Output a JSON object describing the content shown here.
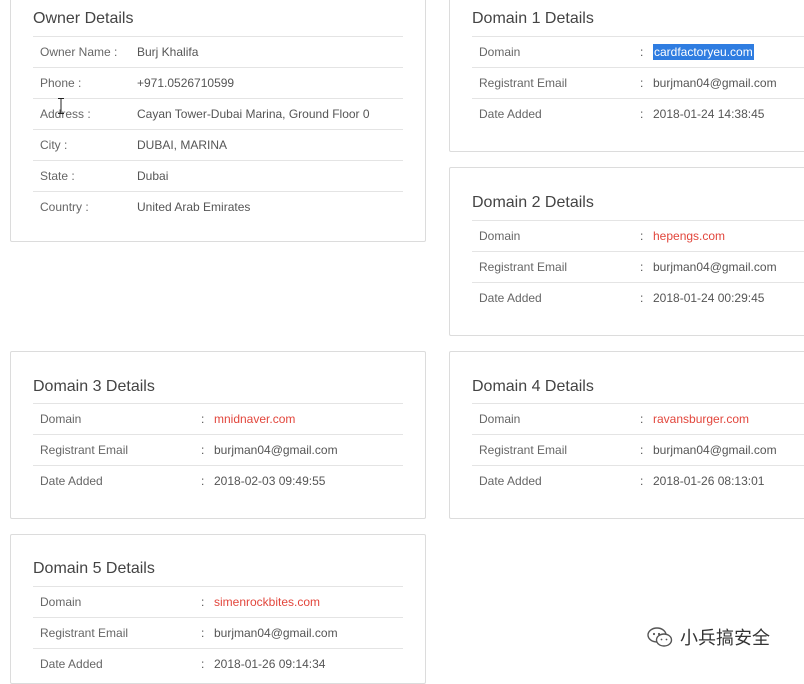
{
  "owner": {
    "title": "Owner Details",
    "rows": [
      {
        "label": "Owner Name :",
        "value": "Burj Khalifa"
      },
      {
        "label": "Phone :",
        "value": "+971.0526710599"
      },
      {
        "label": "Address :",
        "value": "Cayan Tower-Dubai Marina, Ground Floor 0"
      },
      {
        "label": "City :",
        "value": "DUBAI, MARINA"
      },
      {
        "label": "State :",
        "value": "Dubai"
      },
      {
        "label": "Country :",
        "value": "United Arab Emirates"
      }
    ]
  },
  "domains": [
    {
      "title": "Domain 1 Details",
      "rows": [
        {
          "label": "Domain",
          "sep": ":",
          "value": "cardfactoryeu.com"
        },
        {
          "label": "Registrant Email",
          "sep": ":",
          "value": "burjman04@gmail.com"
        },
        {
          "label": "Date Added",
          "sep": ":",
          "value": "2018-01-24 14:38:45"
        }
      ]
    },
    {
      "title": "Domain 2 Details",
      "rows": [
        {
          "label": "Domain",
          "sep": ":",
          "value": "hepengs.com"
        },
        {
          "label": "Registrant Email",
          "sep": ":",
          "value": "burjman04@gmail.com"
        },
        {
          "label": "Date Added",
          "sep": ":",
          "value": "2018-01-24 00:29:45"
        }
      ]
    },
    {
      "title": "Domain 3 Details",
      "rows": [
        {
          "label": "Domain",
          "sep": ":",
          "value": "mnidnaver.com"
        },
        {
          "label": "Registrant Email",
          "sep": ":",
          "value": "burjman04@gmail.com"
        },
        {
          "label": "Date Added",
          "sep": ":",
          "value": "2018-02-03 09:49:55"
        }
      ]
    },
    {
      "title": "Domain 4 Details",
      "rows": [
        {
          "label": "Domain",
          "sep": ":",
          "value": "ravansburger.com"
        },
        {
          "label": "Registrant Email",
          "sep": ":",
          "value": "burjman04@gmail.com"
        },
        {
          "label": "Date Added",
          "sep": ":",
          "value": "2018-01-26 08:13:01"
        }
      ]
    },
    {
      "title": "Domain 5 Details",
      "rows": [
        {
          "label": "Domain",
          "sep": ":",
          "value": "simenrockbites.com"
        },
        {
          "label": "Registrant Email",
          "sep": ":",
          "value": "burjman04@gmail.com"
        },
        {
          "label": "Date Added",
          "sep": ":",
          "value": "2018-01-26 09:14:34"
        }
      ]
    }
  ],
  "watermark": {
    "text": "小兵搞安全",
    "icon": "wechat-icon"
  },
  "colors": {
    "link": "#e2463c",
    "selection": "#2f7de1",
    "border": "#dcdcdc"
  }
}
